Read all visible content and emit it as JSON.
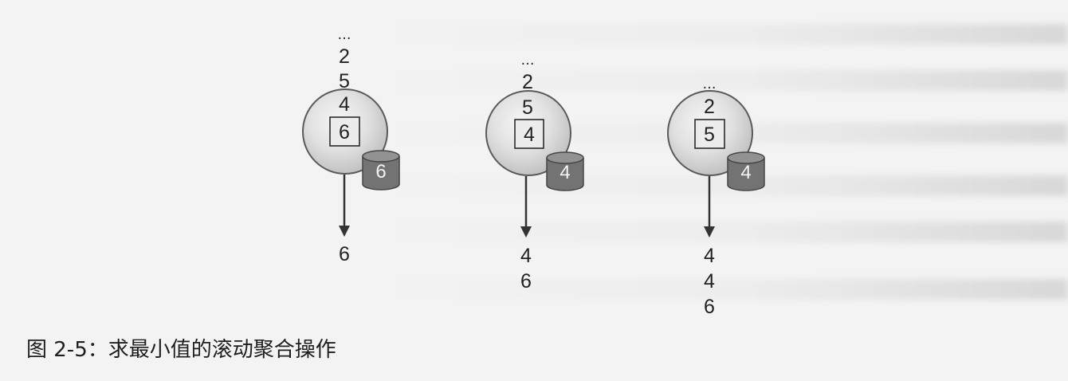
{
  "figure": {
    "caption": "图 2-5：求最小值的滚动聚合操作",
    "diagrams": [
      {
        "inputs": [
          "…",
          "2",
          "5",
          "4"
        ],
        "state": "6",
        "store": "6",
        "outputs": [
          "6"
        ]
      },
      {
        "inputs": [
          "…",
          "2",
          "5"
        ],
        "state": "4",
        "store": "4",
        "outputs": [
          "4",
          "6"
        ]
      },
      {
        "inputs": [
          "…",
          "2"
        ],
        "state": "5",
        "store": "4",
        "outputs": [
          "4",
          "4",
          "6"
        ]
      }
    ]
  },
  "colors": {
    "disc_outline": "#5a5a5a",
    "state_box": "#ececec",
    "state_box_outline": "#2b2b2b",
    "store_body": "#737373",
    "store_top": "#929292",
    "store_outline": "#464646",
    "arrow": "#333333"
  }
}
